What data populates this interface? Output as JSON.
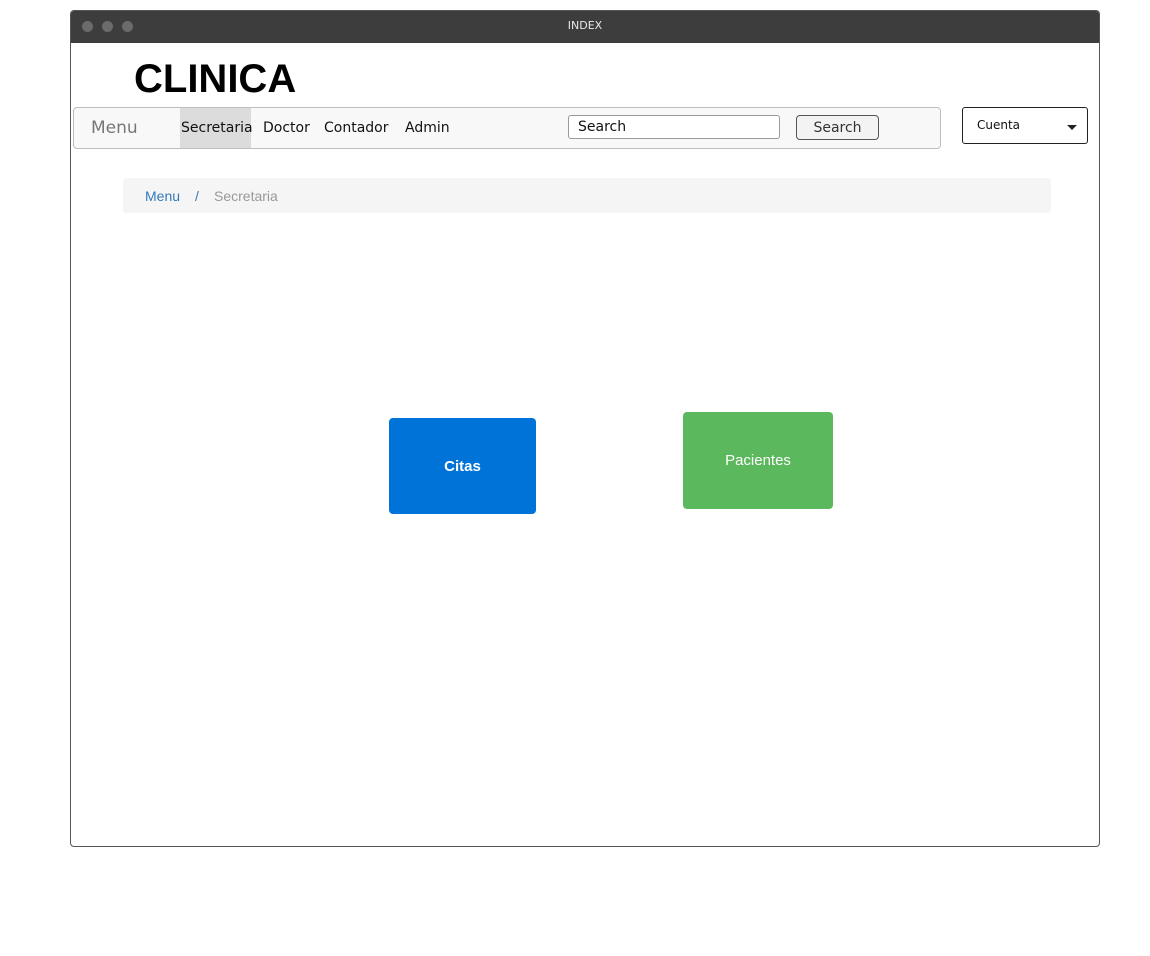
{
  "window": {
    "title": "INDEX"
  },
  "header": {
    "logo": "CLINICA"
  },
  "navbar": {
    "brand": "Menu",
    "items": [
      {
        "label": "Secretaria",
        "active": true
      },
      {
        "label": "Doctor",
        "active": false
      },
      {
        "label": "Contador",
        "active": false
      },
      {
        "label": "Admin",
        "active": false
      }
    ],
    "search": {
      "value": "Search",
      "button_label": "Search"
    }
  },
  "account": {
    "label": "Cuenta",
    "icon": "caret-down-icon"
  },
  "breadcrumb": {
    "items": [
      {
        "label": "Menu",
        "link": true
      },
      {
        "label": "Secretaria",
        "link": false
      }
    ],
    "separator": "/"
  },
  "tiles": [
    {
      "label": "Citas",
      "color": "#0073d9"
    },
    {
      "label": "Pacientes",
      "color": "#5cb85c"
    }
  ],
  "colors": {
    "titlebar": "#3d3d3d",
    "link": "#337ab7",
    "active_nav": "#dcdcdc"
  }
}
